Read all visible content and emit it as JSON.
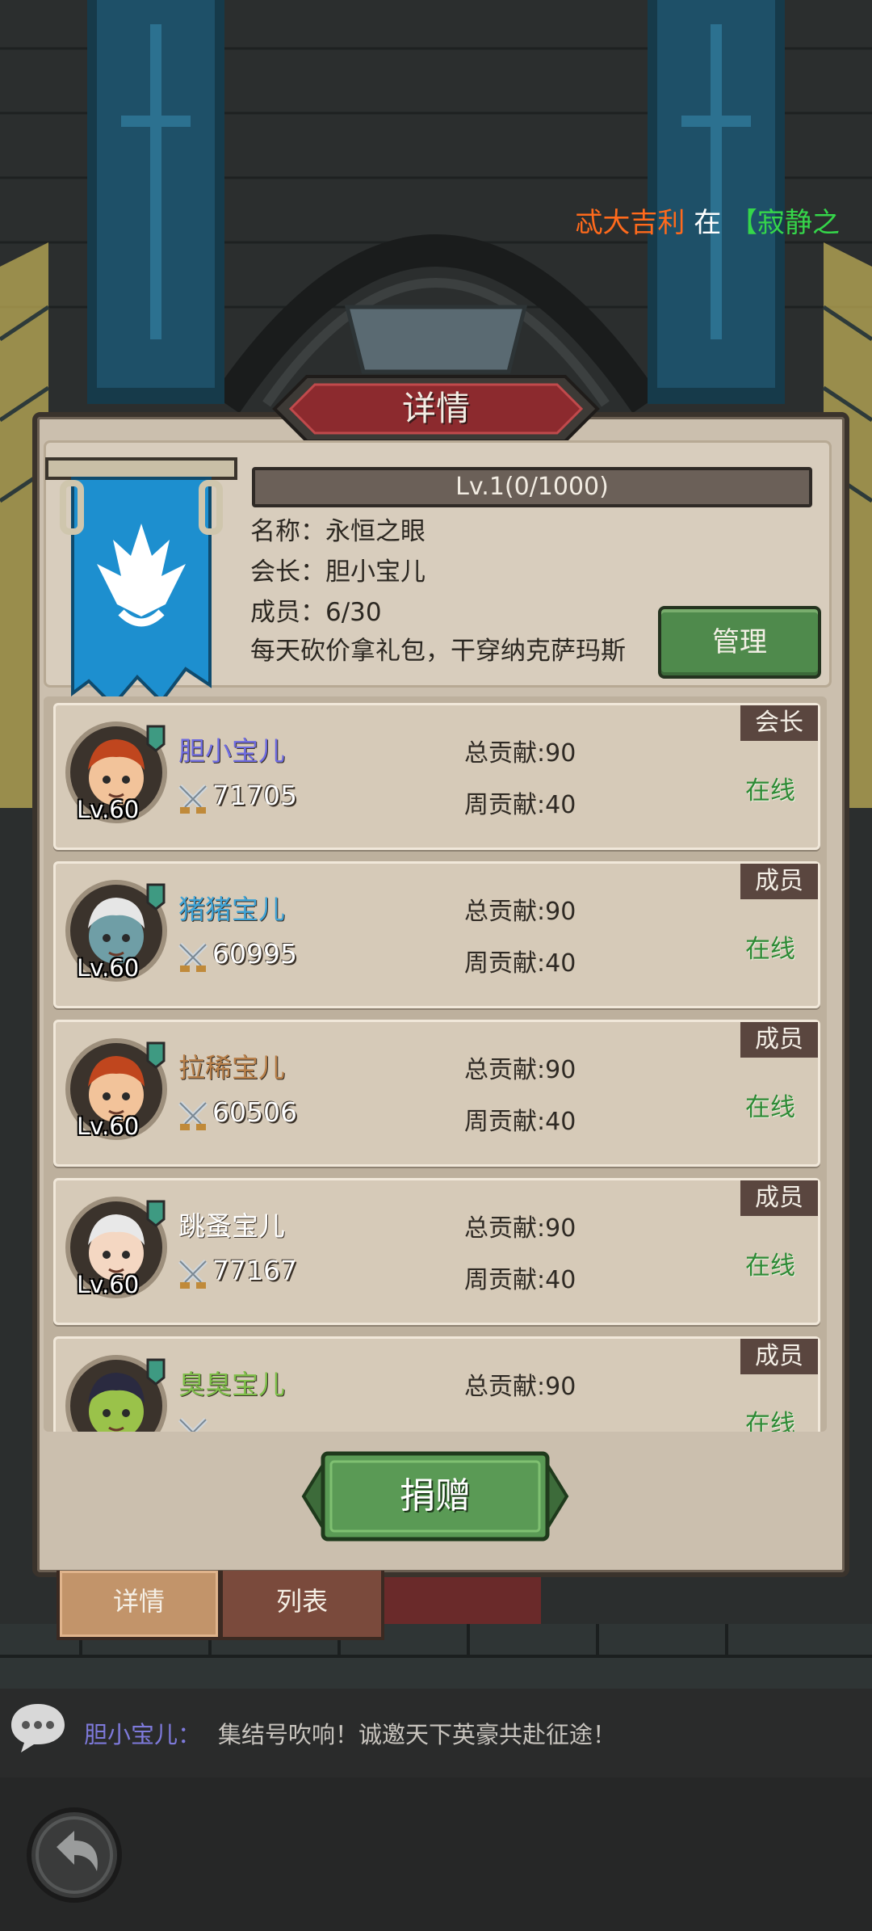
{
  "ticker": {
    "player": "忒大吉利",
    "mid": "在",
    "bracket": "【寂静之"
  },
  "panel": {
    "title": "详情"
  },
  "guild": {
    "level_text": "Lv.1(0/1000)",
    "name_label": "名称：",
    "name_value": "永恒之眼",
    "leader_label": "会长：",
    "leader_value": "胆小宝儿",
    "members_label": "成员：",
    "members_value": "6/30",
    "notice": "每天砍价拿礼包，干穿纳克萨玛斯",
    "manage_label": "管理"
  },
  "labels": {
    "total": "总贡献:",
    "weekly": "周贡献:"
  },
  "members": [
    {
      "name": "胆小宝儿",
      "name_color": "#6f6ce0",
      "level": "Lv.60",
      "power": "71705",
      "total": "90",
      "weekly": "40",
      "role": "会长",
      "status": "在线"
    },
    {
      "name": "猪猪宝儿",
      "name_color": "#3fa3d6",
      "level": "Lv.60",
      "power": "60995",
      "total": "90",
      "weekly": "40",
      "role": "成员",
      "status": "在线"
    },
    {
      "name": "拉稀宝儿",
      "name_color": "#b8804a",
      "level": "Lv.60",
      "power": "60506",
      "total": "90",
      "weekly": "40",
      "role": "成员",
      "status": "在线"
    },
    {
      "name": "跳蚤宝儿",
      "name_color": "#ffffff",
      "level": "Lv.60",
      "power": "77167",
      "total": "90",
      "weekly": "40",
      "role": "成员",
      "status": "在线"
    },
    {
      "name": "臭臭宝儿",
      "name_color": "#7fbf4a",
      "level": "",
      "power": "",
      "total": "90",
      "weekly": "",
      "role": "成员",
      "status": "在线"
    }
  ],
  "donate_label": "捐赠",
  "tabs": {
    "detail": "详情",
    "list": "列表"
  },
  "chat": {
    "name": "胆小宝儿：",
    "message": "集结号吹响！诚邀天下英豪共赴征途！"
  },
  "colors": {
    "ticker_player": "#ff6a1c",
    "ticker_mid": "#ffffff",
    "ticker_bracket": "#35d64a",
    "online": "#2e8a35"
  },
  "icons": [
    "banner-emblem-icon",
    "crossed-swords-icon",
    "chat-bubble-icon",
    "back-arrow-icon"
  ]
}
